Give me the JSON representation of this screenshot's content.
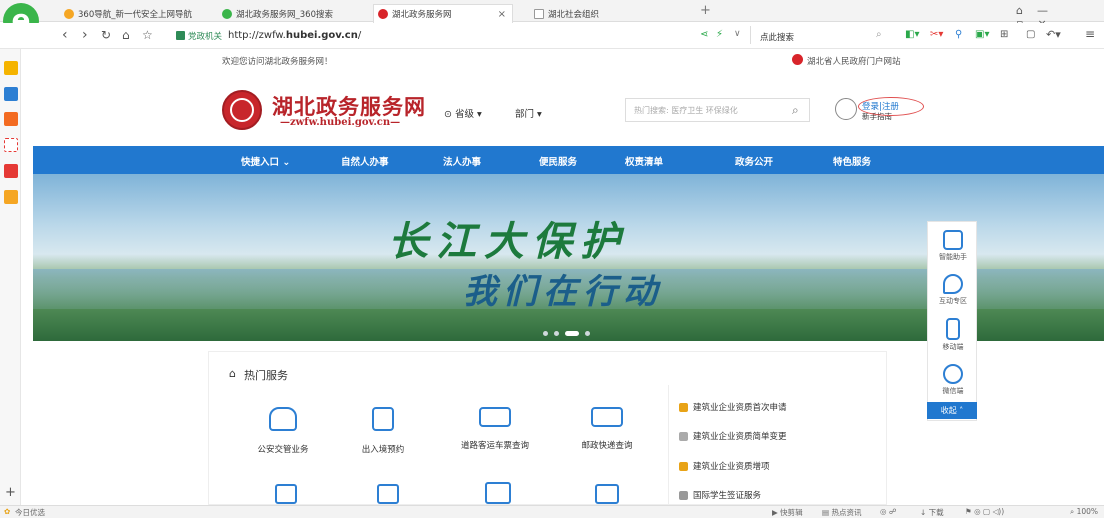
{
  "tabs": [
    {
      "label": "360导航_新一代安全上网导航",
      "icon_color": "#f5a623"
    },
    {
      "label": "湖北政务服务网_360搜索",
      "icon_color": "#3ab54a"
    },
    {
      "label": "湖北政务服务网",
      "icon_color": "#d8242a",
      "active": true
    },
    {
      "label": "湖北社会组织",
      "icon_color": "#999999"
    }
  ],
  "tab_close": "×",
  "tab_new": "+",
  "window_controls": {
    "restore": "▢",
    "minimize": "—",
    "maximize": "▫",
    "close": "×"
  },
  "address": {
    "badge": "党政机关",
    "url_prefix": "http://zwfw.",
    "url_bold": "hubei.gov.cn",
    "url_suffix": "/",
    "search_hint": "点此搜索"
  },
  "statusbar": {
    "left_label": "今日优选",
    "right_items": [
      "快剪辑",
      "热点资讯",
      "下载",
      "100%"
    ]
  },
  "site": {
    "welcome": "欢迎您访问湖北政务服务网！",
    "portal_link": "湖北省人民政府门户网站",
    "title": "湖北政务服务网",
    "url_text": "—zwfw.hubei.gov.cn—",
    "province_select": "省级",
    "dept_select": "部门",
    "search_placeholder": "热门搜索: 医疗卫生 环保绿化",
    "login": "登录",
    "register": "注册",
    "guide": "新手指南"
  },
  "nav": [
    "快捷入口",
    "自然人办事",
    "法人办事",
    "便民服务",
    "权责清单",
    "政务公开",
    "特色服务"
  ],
  "banner": {
    "line1": "长江大保护",
    "line2": "我们在行动"
  },
  "side_float": [
    {
      "label": "智能助手"
    },
    {
      "label": "互动专区"
    },
    {
      "label": "移动端"
    },
    {
      "label": "微信端"
    }
  ],
  "collapse_label": "收起",
  "hot_services": {
    "title": "热门服务",
    "items": [
      "公安交管业务",
      "出入境预约",
      "道路客运车票查询",
      "邮政快递查询"
    ]
  },
  "hot_list": [
    {
      "label": "建筑业企业资质首次申请",
      "rank": "1",
      "color": "#e8a317"
    },
    {
      "label": "建筑业企业资质简单变更",
      "rank": "2",
      "color": "#aaaaaa"
    },
    {
      "label": "建筑业企业资质增项",
      "rank": "3",
      "color": "#e8a317"
    },
    {
      "label": "国际学生签证服务",
      "rank": "4",
      "color": "#999999"
    }
  ]
}
